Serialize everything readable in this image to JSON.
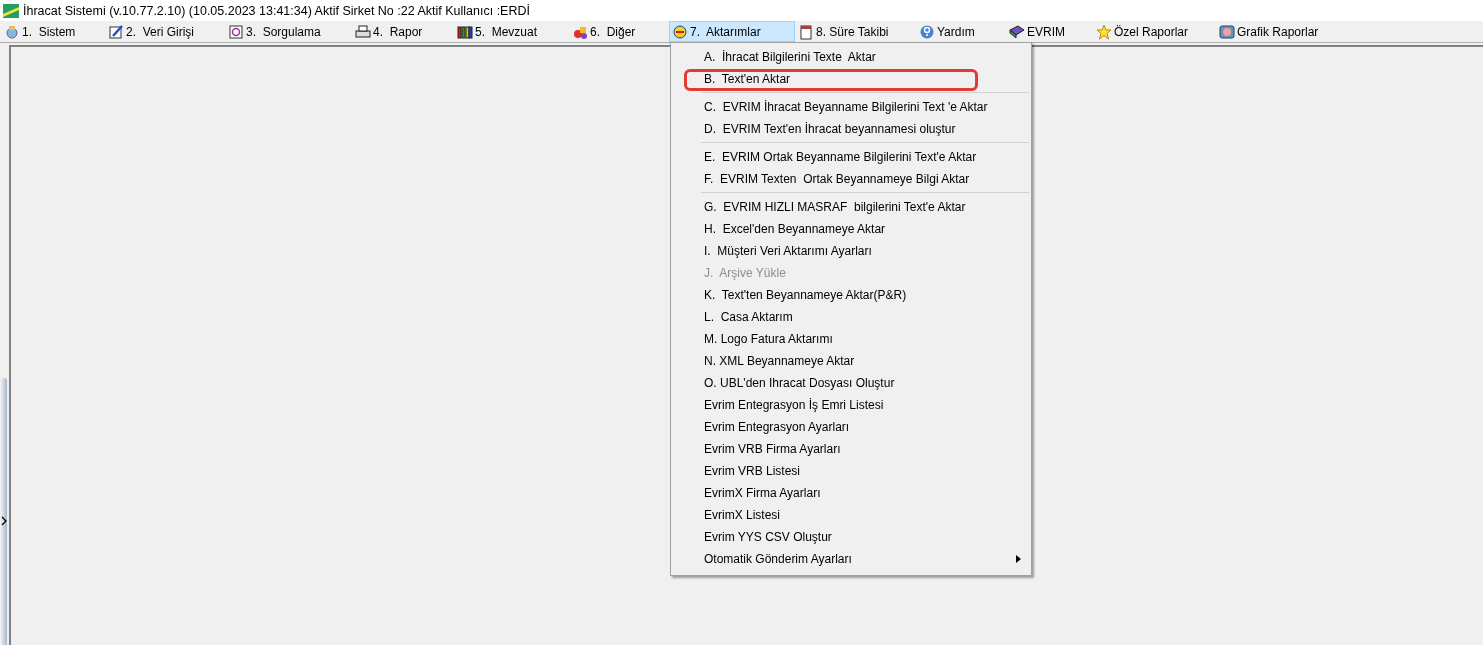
{
  "window": {
    "title": "İhracat Sistemi (v.10.77.2.10) (10.05.2023 13:41:34) Aktif Sirket No :22 Aktif Kullanıcı :ERDİ"
  },
  "menu_bar": [
    {
      "label": "1.  Sistem",
      "selected": false
    },
    {
      "label": "2.  Veri Girişi",
      "selected": false
    },
    {
      "label": "3.  Sorgulama",
      "selected": false
    },
    {
      "label": "4.  Rapor",
      "selected": false
    },
    {
      "label": "5.  Mevzuat",
      "selected": false
    },
    {
      "label": "6.  Diğer",
      "selected": false
    },
    {
      "label": "7.  Aktarımlar",
      "selected": true
    },
    {
      "label": "8. Süre Takibi",
      "selected": false
    },
    {
      "label": "Yardım",
      "selected": false
    },
    {
      "label": "EVRIM",
      "selected": false
    },
    {
      "label": "Özel Raporlar",
      "selected": false
    },
    {
      "label": "Grafik Raporlar",
      "selected": false
    }
  ],
  "dropdown": [
    {
      "kind": "item",
      "label": "A.  İhracat Bilgilerini Texte  Aktar",
      "disabled": false,
      "highlighted": false,
      "submenu": false
    },
    {
      "kind": "item",
      "label": "B.  Text'en Aktar",
      "disabled": false,
      "highlighted": true,
      "submenu": false
    },
    {
      "kind": "separator"
    },
    {
      "kind": "item",
      "label": "C.  EVRIM İhracat Beyanname Bilgilerini Text 'e Aktar",
      "disabled": false,
      "highlighted": false,
      "submenu": false
    },
    {
      "kind": "item",
      "label": "D.  EVRIM Text'en İhracat beyannamesi oluştur",
      "disabled": false,
      "highlighted": false,
      "submenu": false
    },
    {
      "kind": "separator"
    },
    {
      "kind": "item",
      "label": "E.  EVRIM Ortak Beyanname Bilgilerini Text'e Aktar",
      "disabled": false,
      "highlighted": false,
      "submenu": false
    },
    {
      "kind": "item",
      "label": "F.  EVRIM Texten  Ortak Beyannameye Bilgi Aktar",
      "disabled": false,
      "highlighted": false,
      "submenu": false
    },
    {
      "kind": "separator"
    },
    {
      "kind": "item",
      "label": "G.  EVRIM HIZLI MASRAF  bilgilerini Text'e Aktar",
      "disabled": false,
      "highlighted": false,
      "submenu": false
    },
    {
      "kind": "item",
      "label": "H.  Excel'den Beyannameye Aktar",
      "disabled": false,
      "highlighted": false,
      "submenu": false
    },
    {
      "kind": "item",
      "label": "I.  Müşteri Veri Aktarımı Ayarları",
      "disabled": false,
      "highlighted": false,
      "submenu": false
    },
    {
      "kind": "item",
      "label": "J.  Arşive Yükle",
      "disabled": true,
      "highlighted": false,
      "submenu": false
    },
    {
      "kind": "item",
      "label": "K.  Text'ten Beyannameye Aktar(P&R)",
      "disabled": false,
      "highlighted": false,
      "submenu": false
    },
    {
      "kind": "item",
      "label": "L.  Casa Aktarım",
      "disabled": false,
      "highlighted": false,
      "submenu": false
    },
    {
      "kind": "item",
      "label": "M. Logo Fatura Aktarımı",
      "disabled": false,
      "highlighted": false,
      "submenu": false
    },
    {
      "kind": "item",
      "label": "N. XML Beyannameye Aktar",
      "disabled": false,
      "highlighted": false,
      "submenu": false
    },
    {
      "kind": "item",
      "label": "O. UBL'den Ihracat Dosyası Oluştur",
      "disabled": false,
      "highlighted": false,
      "submenu": false
    },
    {
      "kind": "item",
      "label": "Evrim Entegrasyon İş Emri Listesi",
      "disabled": false,
      "highlighted": false,
      "submenu": false
    },
    {
      "kind": "item",
      "label": "Evrim Entegrasyon Ayarları",
      "disabled": false,
      "highlighted": false,
      "submenu": false
    },
    {
      "kind": "item",
      "label": "Evrim VRB Firma Ayarları",
      "disabled": false,
      "highlighted": false,
      "submenu": false
    },
    {
      "kind": "item",
      "label": "Evrim VRB Listesi",
      "disabled": false,
      "highlighted": false,
      "submenu": false
    },
    {
      "kind": "item",
      "label": "EvrimX Firma Ayarları",
      "disabled": false,
      "highlighted": false,
      "submenu": false
    },
    {
      "kind": "item",
      "label": "EvrimX Listesi",
      "disabled": false,
      "highlighted": false,
      "submenu": false
    },
    {
      "kind": "item",
      "label": "Evrim YYS CSV Oluştur",
      "disabled": false,
      "highlighted": false,
      "submenu": false
    },
    {
      "kind": "item",
      "label": "Otomatik Gönderim Ayarları",
      "disabled": false,
      "highlighted": false,
      "submenu": true
    }
  ]
}
